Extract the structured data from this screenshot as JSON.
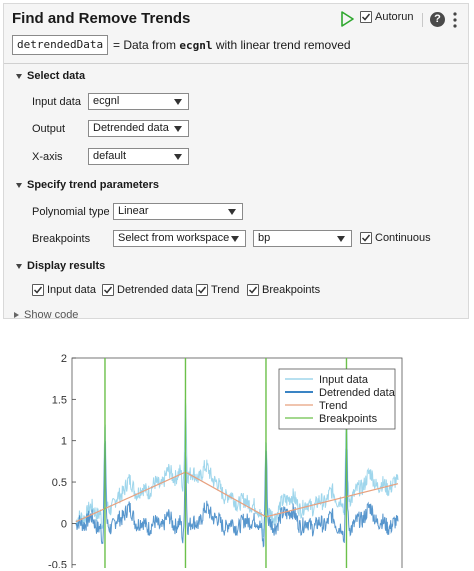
{
  "header": {
    "title": "Find and Remove Trends",
    "autorun_label": "Autorun",
    "help_glyph": "?",
    "output_var": "detrendedData",
    "desc_pre": "= Data from ",
    "desc_var": "ecgnl",
    "desc_post": " with linear trend removed"
  },
  "select_data": {
    "title": "Select data",
    "input_label": "Input data",
    "input_value": "ecgnl",
    "output_label": "Output",
    "output_value": "Detrended data",
    "xaxis_label": "X-axis",
    "xaxis_value": "default"
  },
  "trend": {
    "title": "Specify trend parameters",
    "poly_label": "Polynomial type",
    "poly_value": "Linear",
    "bp_label": "Breakpoints",
    "bp_source": "Select from workspace",
    "bp_var": "bp",
    "continuous_label": "Continuous"
  },
  "display": {
    "title": "Display results",
    "items": [
      "Input data",
      "Detrended data",
      "Trend",
      "Breakpoints"
    ]
  },
  "show_code_label": "Show code",
  "colors": {
    "input": "#9fd6ec",
    "detrended": "#3a84c4",
    "trend": "#e8a07e",
    "breakpoints": "#6cc04a",
    "run_icon": "#2fa82f"
  },
  "chart_data": {
    "type": "line",
    "ylim": [
      -0.6,
      2
    ],
    "yticks": [
      "2",
      "1.5",
      "1",
      "0.5",
      "0",
      "-0.5"
    ],
    "legend_position": "top-right",
    "series": [
      {
        "name": "Input data"
      },
      {
        "name": "Detrended data"
      },
      {
        "name": "Trend"
      },
      {
        "name": "Breakpoints"
      }
    ]
  }
}
